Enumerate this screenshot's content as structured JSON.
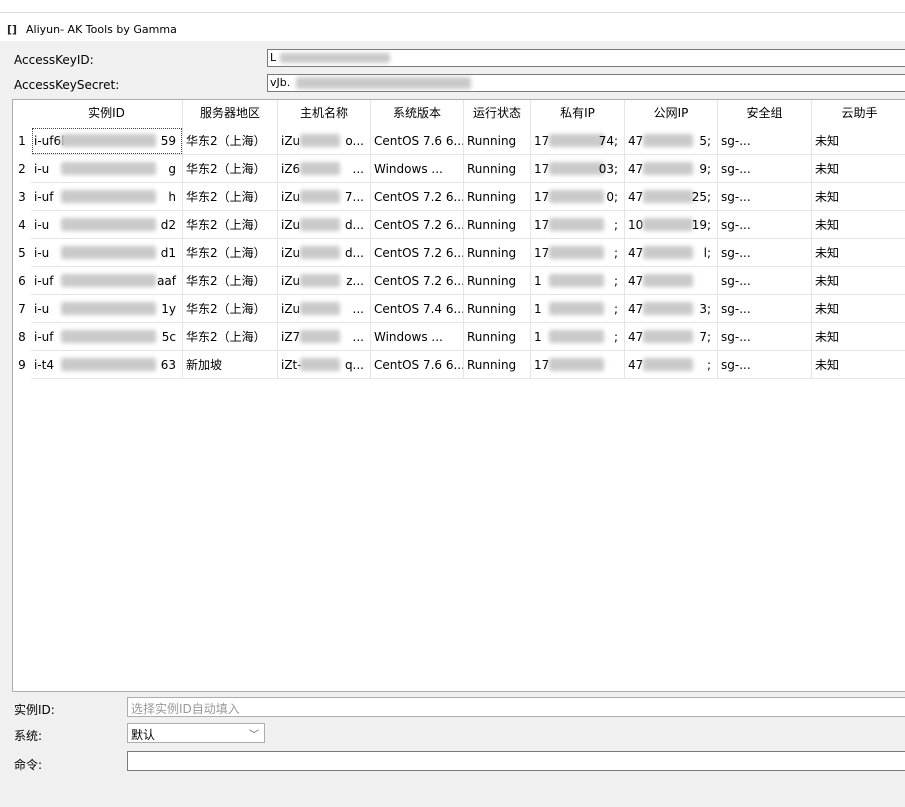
{
  "window": {
    "icon": "window-bracket-icon",
    "icon_glyph": "[]",
    "title": "Aliyun- AK Tools by Gamma"
  },
  "credentials": {
    "access_key_id_label": "AccessKeyID:",
    "access_key_id_value": "L",
    "access_key_secret_label": "AccessKeySecret:",
    "access_key_secret_value": "vJb."
  },
  "table": {
    "columns": [
      "实例ID",
      "服务器地区",
      "主机名称",
      "系统版本",
      "运行状态",
      "私有IP",
      "公网IP",
      "安全组",
      "云助手"
    ],
    "rows": [
      {
        "num": "1",
        "id": "i-uf6l",
        "id_tail": "59",
        "region": "华东2（上海）",
        "host": "iZu",
        "host_tail": "o...",
        "os": "CentOS  7.6 6...",
        "status": "Running",
        "pip": "17",
        "pip_tail": "74;",
        "eip": "47",
        "eip_tail": "5;",
        "sg": "sg-...",
        "assist": "未知"
      },
      {
        "num": "2",
        "id": "i-u",
        "id_tail": "g",
        "region": "华东2（上海）",
        "host": "iZ6",
        "host_tail": "...",
        "os": "Windows ...",
        "status": "Running",
        "pip": "17",
        "pip_tail": "03;",
        "eip": "47",
        "eip_tail": "9;",
        "sg": "sg-...",
        "assist": "未知"
      },
      {
        "num": "3",
        "id": "i-uf",
        "id_tail": "h",
        "region": "华东2（上海）",
        "host": "iZu",
        "host_tail": "7...",
        "os": "CentOS  7.2 6...",
        "status": "Running",
        "pip": "17",
        "pip_tail": "0;",
        "eip": "47",
        "eip_tail": "25;",
        "sg": "sg-...",
        "assist": "未知"
      },
      {
        "num": "4",
        "id": "i-u",
        "id_tail": "d2",
        "region": "华东2（上海）",
        "host": "iZu",
        "host_tail": "d...",
        "os": "CentOS  7.2 6...",
        "status": "Running",
        "pip": "17",
        "pip_tail": ";",
        "eip": "10",
        "eip_tail": "19;",
        "sg": "sg-...",
        "assist": "未知"
      },
      {
        "num": "5",
        "id": "i-u",
        "id_tail": "d1",
        "region": "华东2（上海）",
        "host": "iZu",
        "host_tail": "d...",
        "os": "CentOS  7.2 6...",
        "status": "Running",
        "pip": "17",
        "pip_tail": ";",
        "eip": "47",
        "eip_tail": "l;",
        "sg": "sg-...",
        "assist": "未知"
      },
      {
        "num": "6",
        "id": "i-uf",
        "id_tail": "aaf",
        "region": "华东2（上海）",
        "host": "iZu",
        "host_tail": "z...",
        "os": "CentOS  7.2 6...",
        "status": "Running",
        "pip": "1",
        "pip_tail": ";",
        "eip": "47",
        "eip_tail": "",
        "sg": "sg-...",
        "assist": "未知"
      },
      {
        "num": "7",
        "id": "i-u",
        "id_tail": "1y",
        "region": "华东2（上海）",
        "host": "iZu",
        "host_tail": "...",
        "os": "CentOS  7.4 6...",
        "status": "Running",
        "pip": "1",
        "pip_tail": ";",
        "eip": "47",
        "eip_tail": "3;",
        "sg": "sg-...",
        "assist": "未知"
      },
      {
        "num": "8",
        "id": "i-uf",
        "id_tail": "5c",
        "region": "华东2（上海）",
        "host": "iZ7",
        "host_tail": "...",
        "os": "Windows ...",
        "status": "Running",
        "pip": "1",
        "pip_tail": ";",
        "eip": "47",
        "eip_tail": "7;",
        "sg": "sg-...",
        "assist": "未知"
      },
      {
        "num": "9",
        "id": "i-t4",
        "id_tail": "63",
        "region": "新加坡",
        "host": "iZt-",
        "host_tail": "q...",
        "os": "CentOS  7.6 6...",
        "status": "Running",
        "pip": "17",
        "pip_tail": "",
        "eip": "47",
        "eip_tail": ";",
        "sg": "sg-...",
        "assist": "未知"
      }
    ]
  },
  "form": {
    "instance_label": "实例ID:",
    "instance_placeholder": "选择实例ID自动填入",
    "system_label": "系统:",
    "system_value": "默认",
    "system_chevron": "chevron-down-icon",
    "system_chevron_glyph": "﹀",
    "command_label": "命令:"
  }
}
